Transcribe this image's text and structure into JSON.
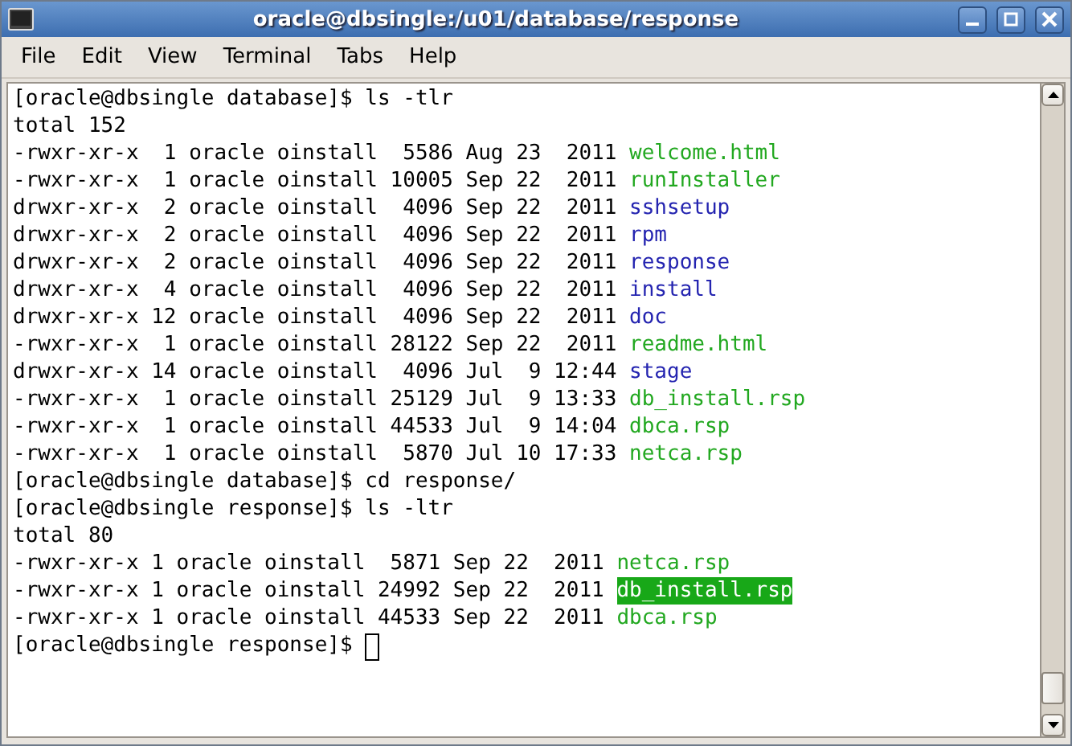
{
  "window": {
    "title": "oracle@dbsingle:/u01/database/response"
  },
  "menu": [
    "File",
    "Edit",
    "View",
    "Terminal",
    "Tabs",
    "Help"
  ],
  "terminal": {
    "lines": [
      {
        "text": "[oracle@dbsingle database]$ ls -tlr"
      },
      {
        "text": "total 152"
      },
      {
        "text": "-rwxr-xr-x  1 oracle oinstall  5586 Aug 23  2011 ",
        "file": {
          "name": "welcome.html",
          "kind": "executable",
          "selected": false
        }
      },
      {
        "text": "-rwxr-xr-x  1 oracle oinstall 10005 Sep 22  2011 ",
        "file": {
          "name": "runInstaller",
          "kind": "executable",
          "selected": false
        }
      },
      {
        "text": "drwxr-xr-x  2 oracle oinstall  4096 Sep 22  2011 ",
        "file": {
          "name": "sshsetup",
          "kind": "directory",
          "selected": false
        }
      },
      {
        "text": "drwxr-xr-x  2 oracle oinstall  4096 Sep 22  2011 ",
        "file": {
          "name": "rpm",
          "kind": "directory",
          "selected": false
        }
      },
      {
        "text": "drwxr-xr-x  2 oracle oinstall  4096 Sep 22  2011 ",
        "file": {
          "name": "response",
          "kind": "directory",
          "selected": false
        }
      },
      {
        "text": "drwxr-xr-x  4 oracle oinstall  4096 Sep 22  2011 ",
        "file": {
          "name": "install",
          "kind": "directory",
          "selected": false
        }
      },
      {
        "text": "drwxr-xr-x 12 oracle oinstall  4096 Sep 22  2011 ",
        "file": {
          "name": "doc",
          "kind": "directory",
          "selected": false
        }
      },
      {
        "text": "-rwxr-xr-x  1 oracle oinstall 28122 Sep 22  2011 ",
        "file": {
          "name": "readme.html",
          "kind": "executable",
          "selected": false
        }
      },
      {
        "text": "drwxr-xr-x 14 oracle oinstall  4096 Jul  9 12:44 ",
        "file": {
          "name": "stage",
          "kind": "directory",
          "selected": false
        }
      },
      {
        "text": "-rwxr-xr-x  1 oracle oinstall 25129 Jul  9 13:33 ",
        "file": {
          "name": "db_install.rsp",
          "kind": "executable",
          "selected": false
        }
      },
      {
        "text": "-rwxr-xr-x  1 oracle oinstall 44533 Jul  9 14:04 ",
        "file": {
          "name": "dbca.rsp",
          "kind": "executable",
          "selected": false
        }
      },
      {
        "text": "-rwxr-xr-x  1 oracle oinstall  5870 Jul 10 17:33 ",
        "file": {
          "name": "netca.rsp",
          "kind": "executable",
          "selected": false
        }
      },
      {
        "text": "[oracle@dbsingle database]$ cd response/"
      },
      {
        "text": "[oracle@dbsingle response]$ ls -ltr"
      },
      {
        "text": "total 80"
      },
      {
        "text": "-rwxr-xr-x 1 oracle oinstall  5871 Sep 22  2011 ",
        "file": {
          "name": "netca.rsp",
          "kind": "executable",
          "selected": false
        }
      },
      {
        "text": "-rwxr-xr-x 1 oracle oinstall 24992 Sep 22  2011 ",
        "file": {
          "name": "db_install.rsp",
          "kind": "executable",
          "selected": true
        }
      },
      {
        "text": "-rwxr-xr-x 1 oracle oinstall 44533 Sep 22  2011 ",
        "file": {
          "name": "dbca.rsp",
          "kind": "executable",
          "selected": false
        }
      },
      {
        "text": "[oracle@dbsingle response]$ ",
        "cursor": true
      }
    ]
  }
}
